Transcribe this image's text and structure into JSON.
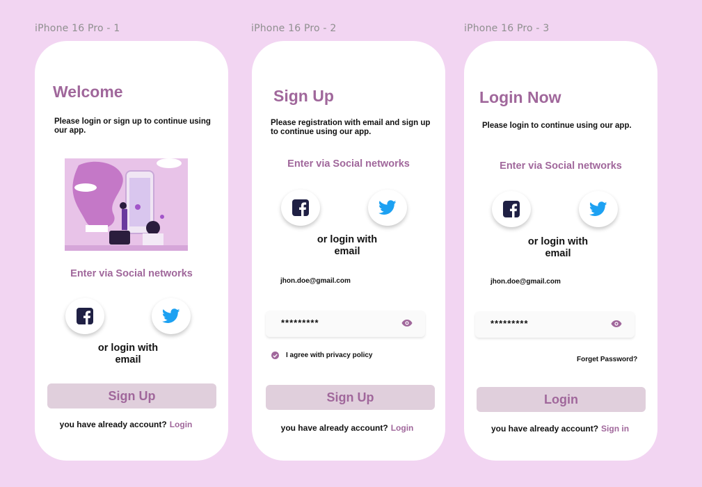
{
  "frames": [
    {
      "label": "iPhone 16 Pro - 1",
      "title": "Welcome",
      "subtitle_line1": "Please login  or sign up to continue using",
      "subtitle_line2": "our app.",
      "social_heading": "Enter via Social networks",
      "or_line1": "or login with",
      "or_line2": "email",
      "primary_button": "Sign Up",
      "footer_text": "you have already account?",
      "footer_link": "Login"
    },
    {
      "label": "iPhone 16 Pro - 2",
      "title": "Sign Up",
      "subtitle_line1": "Please registration with email and sign up",
      "subtitle_line2": "to continue using our app.",
      "social_heading": "Enter via Social networks",
      "or_line1": "or login with",
      "or_line2": "email",
      "email_value": "jhon.doe@gmail.com",
      "password_value": "*********",
      "privacy_label": "I agree with privacy policy",
      "privacy_checked": true,
      "primary_button": "Sign Up",
      "footer_text": "you have already account?",
      "footer_link": "Login"
    },
    {
      "label": "iPhone 16 Pro - 3",
      "title": "Login Now",
      "subtitle_line1": "Please login to continue using our app.",
      "social_heading": "Enter via Social networks",
      "or_line1": "or login with",
      "or_line2": "email",
      "email_value": "jhon.doe@gmail.com",
      "password_value": "*********",
      "forgot_password": "Forget Password?",
      "primary_button": "Login",
      "footer_text": "you have already account?",
      "footer_link": "Sign in"
    }
  ],
  "icons": {
    "facebook": "facebook-icon",
    "twitter": "twitter-icon",
    "eye": "eye-icon",
    "check": "check-icon"
  },
  "colors": {
    "background": "#f2d5f2",
    "accent": "#a0679b",
    "button_bg": "#e0cfdc",
    "facebook": "#1f2044",
    "twitter": "#1da1f2"
  }
}
